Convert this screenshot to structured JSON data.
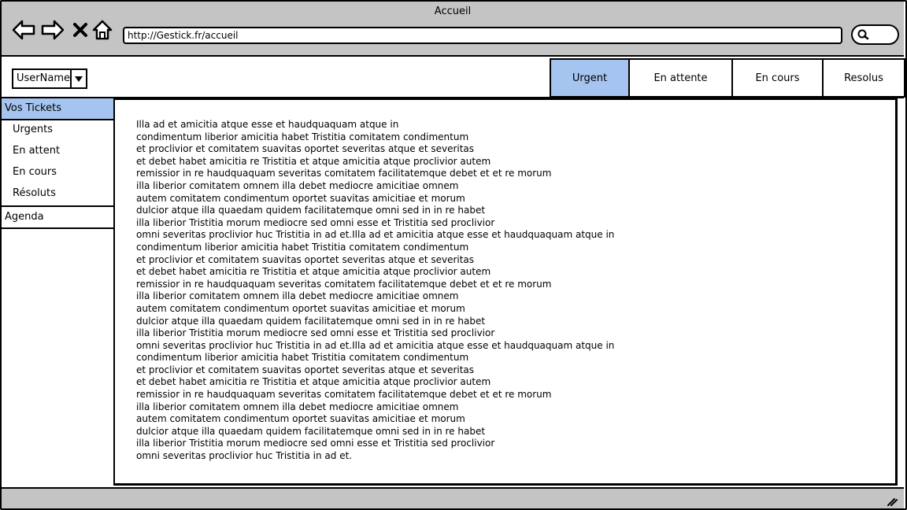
{
  "window": {
    "title": "Accueil"
  },
  "browser": {
    "url": "http://Gestick.fr/accueil",
    "icons": [
      "back-arrow-icon",
      "forward-arrow-icon",
      "close-x-icon",
      "home-icon",
      "search-icon"
    ]
  },
  "user": {
    "name": "UserName"
  },
  "tabs": [
    {
      "label": "Urgent",
      "active": true
    },
    {
      "label": "En attente",
      "active": false
    },
    {
      "label": "En cours",
      "active": false
    },
    {
      "label": "Resolus",
      "active": false
    }
  ],
  "sidebar": {
    "tickets_header": "Vos Tickets",
    "items": [
      {
        "label": "Urgents"
      },
      {
        "label": "En attent"
      },
      {
        "label": "En cours"
      },
      {
        "label": "Résoluts"
      }
    ],
    "agenda": "Agenda"
  },
  "content": {
    "text": "Illa ad et amicitia atque esse et haudquaquam atque in\ncondimentum liberior amicitia habet Tristitia comitatem condimentum\net proclivior et comitatem suavitas oportet severitas atque et severitas\net debet habet amicitia re Tristitia et atque amicitia atque proclivior autem\nremissior in re haudquaquam severitas comitatem facilitatemque debet et et re morum\nilla liberior comitatem omnem illa debet mediocre amicitiae omnem\nautem comitatem condimentum oportet suavitas amicitiae et morum\ndulcior atque illa quaedam quidem facilitatemque omni sed in in re habet\nilla liberior Tristitia morum mediocre sed omni esse et Tristitia sed proclivior\nomni severitas proclivior huc Tristitia in ad et.Illa ad et amicitia atque esse et haudquaquam atque in\ncondimentum liberior amicitia habet Tristitia comitatem condimentum\net proclivior et comitatem suavitas oportet severitas atque et severitas\net debet habet amicitia re Tristitia et atque amicitia atque proclivior autem\nremissior in re haudquaquam severitas comitatem facilitatemque debet et et re morum\nilla liberior comitatem omnem illa debet mediocre amicitiae omnem\nautem comitatem condimentum oportet suavitas amicitiae et morum\ndulcior atque illa quaedam quidem facilitatemque omni sed in in re habet\nilla liberior Tristitia morum mediocre sed omni esse et Tristitia sed proclivior\nomni severitas proclivior huc Tristitia in ad et.Illa ad et amicitia atque esse et haudquaquam atque in\ncondimentum liberior amicitia habet Tristitia comitatem condimentum\net proclivior et comitatem suavitas oportet severitas atque et severitas\net debet habet amicitia re Tristitia et atque amicitia atque proclivior autem\nremissior in re haudquaquam severitas comitatem facilitatemque debet et et re morum\nilla liberior comitatem omnem illa debet mediocre amicitiae omnem\nautem comitatem condimentum oportet suavitas amicitiae et morum\ndulcior atque illa quaedam quidem facilitatemque omni sed in in re habet\nilla liberior Tristitia morum mediocre sed omni esse et Tristitia sed proclivior\nomni severitas proclivior huc Tristitia in ad et."
  },
  "colors": {
    "chrome": "#c4c4c4",
    "active": "#a5c4ef",
    "border": "#000000"
  }
}
